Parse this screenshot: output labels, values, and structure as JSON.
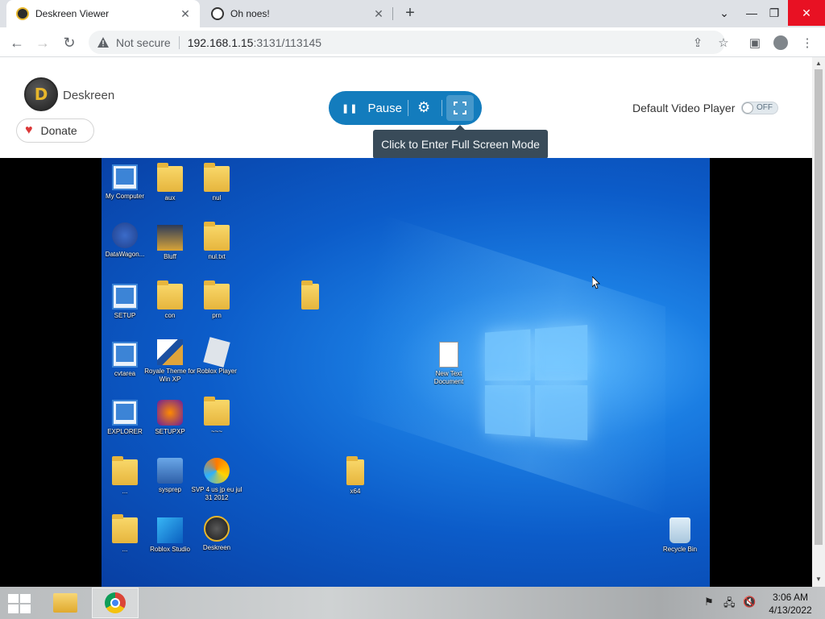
{
  "browser": {
    "tabs": [
      {
        "title": "Deskreen Viewer",
        "active": true
      },
      {
        "title": "Oh noes!",
        "active": false
      }
    ],
    "new_tab": "+",
    "address": {
      "security": "Not secure",
      "host": "192.168.1.15",
      "path": ":3131/113145"
    }
  },
  "app": {
    "brand": "Deskreen",
    "logo_letter": "D",
    "donate_label": "Donate",
    "pause_label": "Pause",
    "tooltip": "Click to Enter Full Screen Mode",
    "default_player_label": "Default Video Player",
    "switch_label": "OFF",
    "accent": "#137cbd"
  },
  "remote_desktop": {
    "icons": [
      {
        "label": "My Computer"
      },
      {
        "label": "aux"
      },
      {
        "label": "nul"
      },
      {
        "label": "DataWagon..."
      },
      {
        "label": "Bluff"
      },
      {
        "label": "nul.txt"
      },
      {
        "label": "SETUP"
      },
      {
        "label": "con"
      },
      {
        "label": "prn"
      },
      {
        "label": "cvtarea"
      },
      {
        "label": "Royale Theme for Win XP"
      },
      {
        "label": "Roblox Player"
      },
      {
        "label": "New Text Document"
      },
      {
        "label": "EXPLORER"
      },
      {
        "label": "SETUPXP"
      },
      {
        "label": "~~~"
      },
      {
        "label": "..."
      },
      {
        "label": "sysprep"
      },
      {
        "label": "SVP 4 us jp eu jul 31 2012"
      },
      {
        "label": "x64"
      },
      {
        "label": "..."
      },
      {
        "label": "Roblox Studio"
      },
      {
        "label": "Deskreen"
      },
      {
        "label": "Recycle Bin"
      }
    ]
  },
  "taskbar": {
    "time": "3:06 AM",
    "date": "4/13/2022"
  }
}
